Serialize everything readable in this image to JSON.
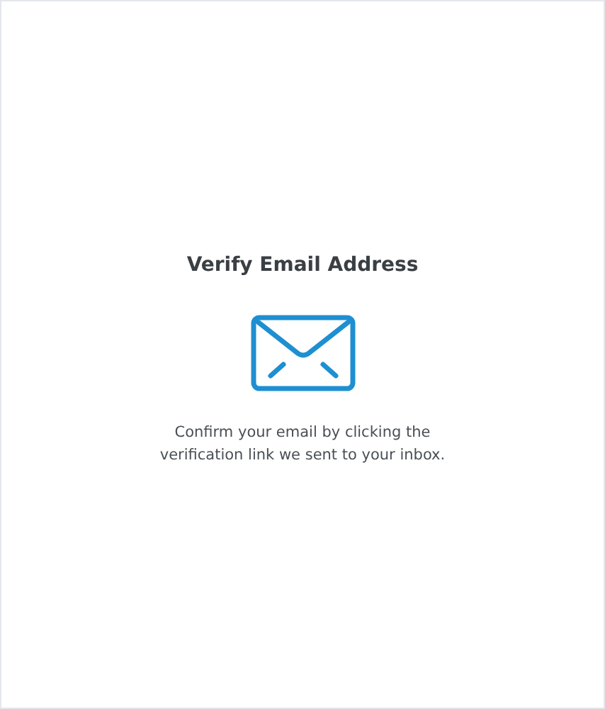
{
  "title": "Verify Email Address",
  "message": "Confirm your email by clicking the verification link we sent to your inbox."
}
